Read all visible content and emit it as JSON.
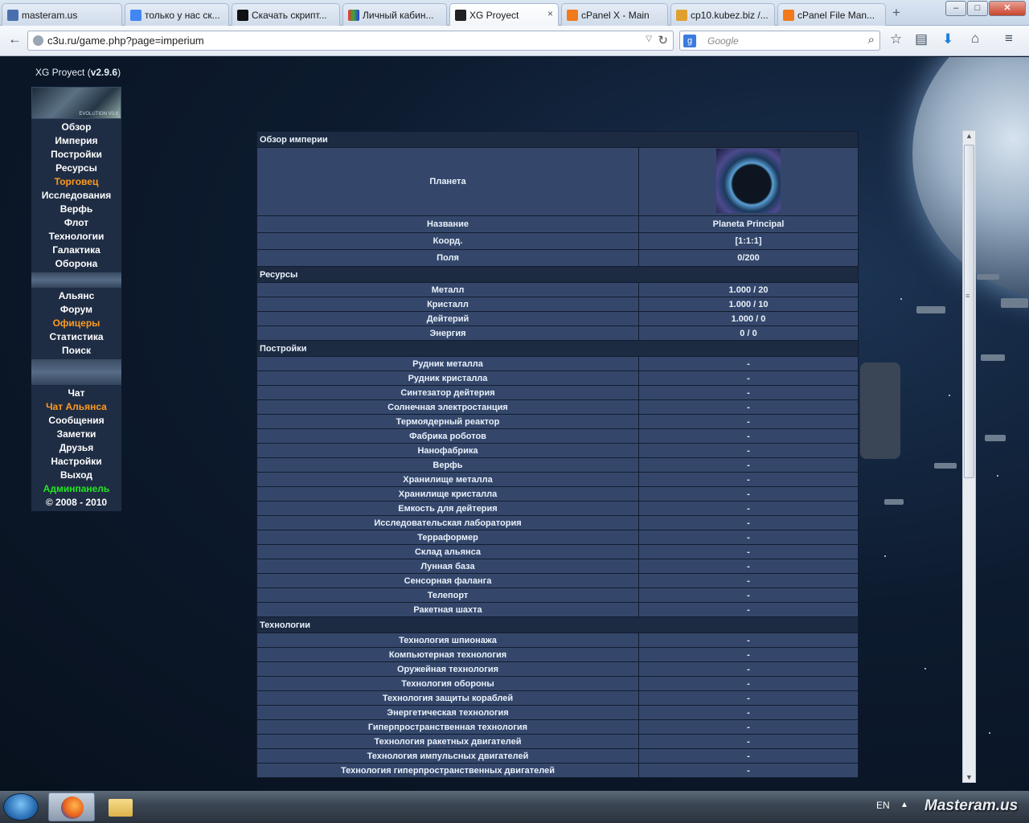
{
  "browser": {
    "tabs": [
      {
        "title": "masteram.us",
        "active": false
      },
      {
        "title": "только у нас ск...",
        "active": false
      },
      {
        "title": "Скачать скрипт...",
        "active": false
      },
      {
        "title": "Личный кабин...",
        "active": false
      },
      {
        "title": "XG Proyect",
        "active": true
      },
      {
        "title": "cPanel X - Main",
        "active": false
      },
      {
        "title": "cp10.kubez.biz /...",
        "active": false
      },
      {
        "title": "cPanel File Man...",
        "active": false
      }
    ],
    "url": "c3u.ru/game.php?page=imperium",
    "search_placeholder": "Google",
    "new_tab": "+",
    "tab_close": "×"
  },
  "game": {
    "version_prefix": "XG Proyect (",
    "version": "v2.9.6",
    "version_suffix": ")",
    "logo_text": "EVOLUTION V0.8",
    "menu_main": [
      "Обзор",
      "Империя",
      "Постройки",
      "Ресурсы",
      "Торговец",
      "Исследования",
      "Верфь",
      "Флот",
      "Технологии",
      "Галактика",
      "Оборона"
    ],
    "menu_social": [
      "Альянс",
      "Форум",
      "Офицеры",
      "Статистика",
      "Поиск"
    ],
    "menu_misc": [
      "Чат",
      "Чат Альянса",
      "Сообщения",
      "Заметки",
      "Друзья",
      "Настройки",
      "Выход",
      "Админпанель"
    ],
    "copyright": "© 2008 - 2010",
    "colors": {
      "highlight": "#ff9a1f",
      "admin": "#22e622"
    }
  },
  "empire": {
    "title": "Обзор империи",
    "planet_label": "Планета",
    "info_rows": [
      {
        "label": "Название",
        "value": "Planeta Principal"
      },
      {
        "label": "Коорд.",
        "value": "[1:1:1]"
      },
      {
        "label": "Поля",
        "value": "0/200"
      }
    ],
    "resources_title": "Ресурсы",
    "resources": [
      {
        "label": "Металл",
        "value": "1.000 / 20"
      },
      {
        "label": "Кристалл",
        "value": "1.000 / 10"
      },
      {
        "label": "Дейтерий",
        "value": "1.000 / 0"
      },
      {
        "label": "Энергия",
        "value": "0 / 0"
      }
    ],
    "buildings_title": "Постройки",
    "buildings": [
      {
        "label": "Рудник металла",
        "value": "-"
      },
      {
        "label": "Рудник кристалла",
        "value": "-"
      },
      {
        "label": "Синтезатор дейтерия",
        "value": "-"
      },
      {
        "label": "Солнечная электростанция",
        "value": "-"
      },
      {
        "label": "Термоядерный реактор",
        "value": "-"
      },
      {
        "label": "Фабрика роботов",
        "value": "-"
      },
      {
        "label": "Нанофабрика",
        "value": "-"
      },
      {
        "label": "Верфь",
        "value": "-"
      },
      {
        "label": "Хранилище металла",
        "value": "-"
      },
      {
        "label": "Хранилище кристалла",
        "value": "-"
      },
      {
        "label": "Емкость для дейтерия",
        "value": "-"
      },
      {
        "label": "Исследовательская лаборатория",
        "value": "-"
      },
      {
        "label": "Терраформер",
        "value": "-"
      },
      {
        "label": "Склад альянса",
        "value": "-"
      },
      {
        "label": "Лунная база",
        "value": "-"
      },
      {
        "label": "Сенсорная фаланга",
        "value": "-"
      },
      {
        "label": "Телепорт",
        "value": "-"
      },
      {
        "label": "Ракетная шахта",
        "value": "-"
      }
    ],
    "tech_title": "Технологии",
    "tech": [
      {
        "label": "Технология шпионажа",
        "value": "-"
      },
      {
        "label": "Компьютерная технология",
        "value": "-"
      },
      {
        "label": "Оружейная технология",
        "value": "-"
      },
      {
        "label": "Технология обороны",
        "value": "-"
      },
      {
        "label": "Технология защиты кораблей",
        "value": "-"
      },
      {
        "label": "Энергетическая технология",
        "value": "-"
      },
      {
        "label": "Гиперпространственная технология",
        "value": "-"
      },
      {
        "label": "Технология ракетных двигателей",
        "value": "-"
      },
      {
        "label": "Технология импульсных двигателей",
        "value": "-"
      },
      {
        "label": "Технология гиперпространственных двигателей",
        "value": "-"
      }
    ]
  },
  "taskbar": {
    "language": "EN",
    "watermark": "Masteram.us"
  }
}
